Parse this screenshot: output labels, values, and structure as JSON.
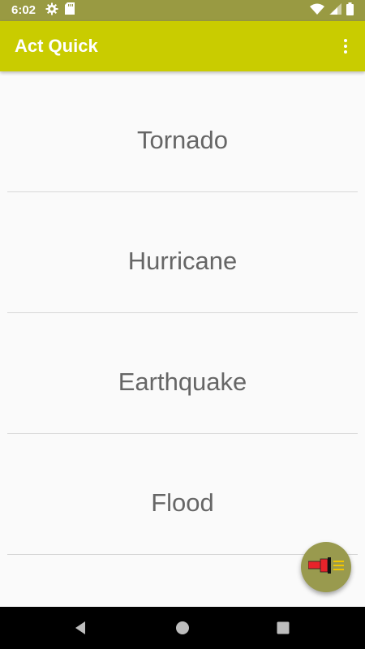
{
  "status_bar": {
    "time": "6:02",
    "left_icons": [
      "gear-icon",
      "sd-card-icon"
    ],
    "right_icons": [
      "wifi-icon",
      "cell-signal-icon",
      "battery-icon"
    ]
  },
  "app_bar": {
    "title": "Act Quick",
    "overflow_icon": "more-vertical-icon"
  },
  "list": {
    "items": [
      {
        "label": "Tornado"
      },
      {
        "label": "Hurricane"
      },
      {
        "label": "Earthquake"
      },
      {
        "label": "Flood"
      }
    ]
  },
  "fab": {
    "icon": "flashlight-menu-icon"
  },
  "nav_bar": {
    "buttons": [
      "back-icon",
      "home-icon",
      "recents-icon"
    ]
  },
  "colors": {
    "status_bar": "#999a42",
    "app_bar": "#c9cc00",
    "fab": "#999a4e",
    "text_primary": "#666666",
    "background": "#fafafa",
    "nav_bar": "#000000"
  }
}
